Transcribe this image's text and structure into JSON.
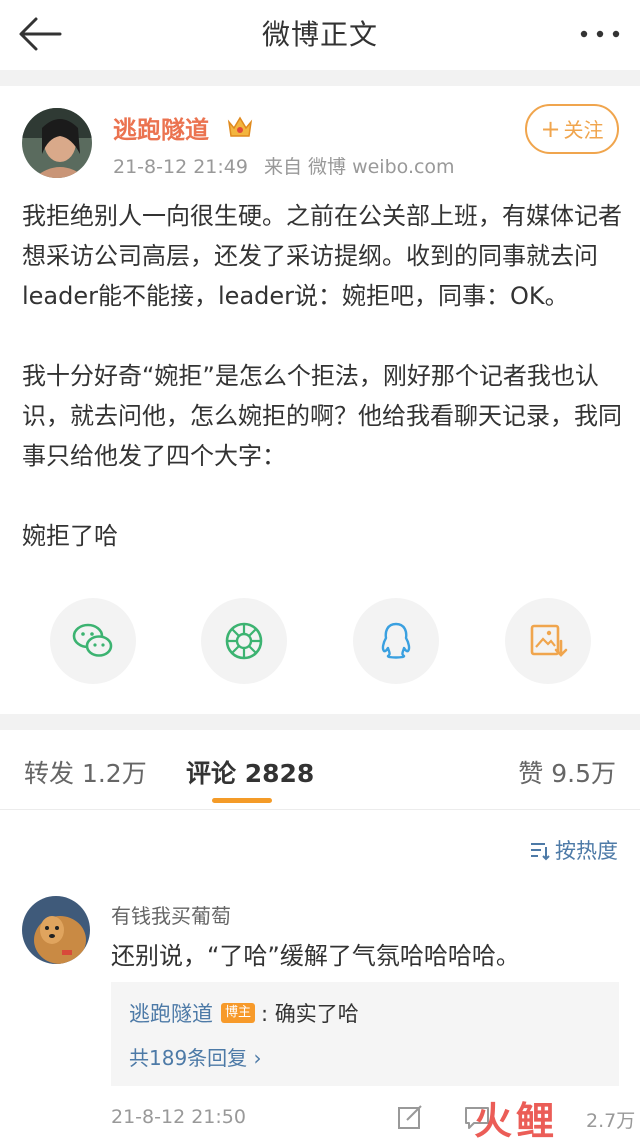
{
  "nav": {
    "title": "微博正文"
  },
  "post": {
    "author": "逃跑隧道",
    "time": "21-8-12 21:49",
    "source": "来自 微博 weibo.com",
    "follow_label": "关注",
    "paragraphs": [
      "我拒绝别人一向很生硬。之前在公关部上班，有媒体记者想采访公司高层，还发了采访提纲。收到的同事就去问leader能不能接，leader说：婉拒吧，同事：OK。",
      "我十分好奇“婉拒”是怎么个拒法，刚好那个记者我也认识，就去问他，怎么婉拒的啊？他给我看聊天记录，我同事只给他发了四个大字：",
      "婉拒了哈"
    ]
  },
  "share": {
    "icons": [
      "wechat-icon",
      "moments-icon",
      "qq-icon",
      "save-image-icon"
    ],
    "colors": {
      "wechat": "#3cb371",
      "moments": "#3cb371",
      "qq": "#3aa0e0",
      "save": "#f0a54d"
    }
  },
  "tabs": {
    "repost": "转发 1.2万",
    "comment": "评论 2828",
    "like": "赞 9.5万"
  },
  "sort_label": "按热度",
  "comment": {
    "user": "有钱我买葡萄",
    "text": "还别说，“了哈”缓解了气氛哈哈哈哈。",
    "reply_user": "逃跑隧道",
    "reply_badge": "博主",
    "reply_text": ": 确实了哈",
    "reply_more": "共189条回复 ›",
    "time": "21-8-12 21:50",
    "like_count": "2.7万"
  },
  "watermark": "火鲤"
}
